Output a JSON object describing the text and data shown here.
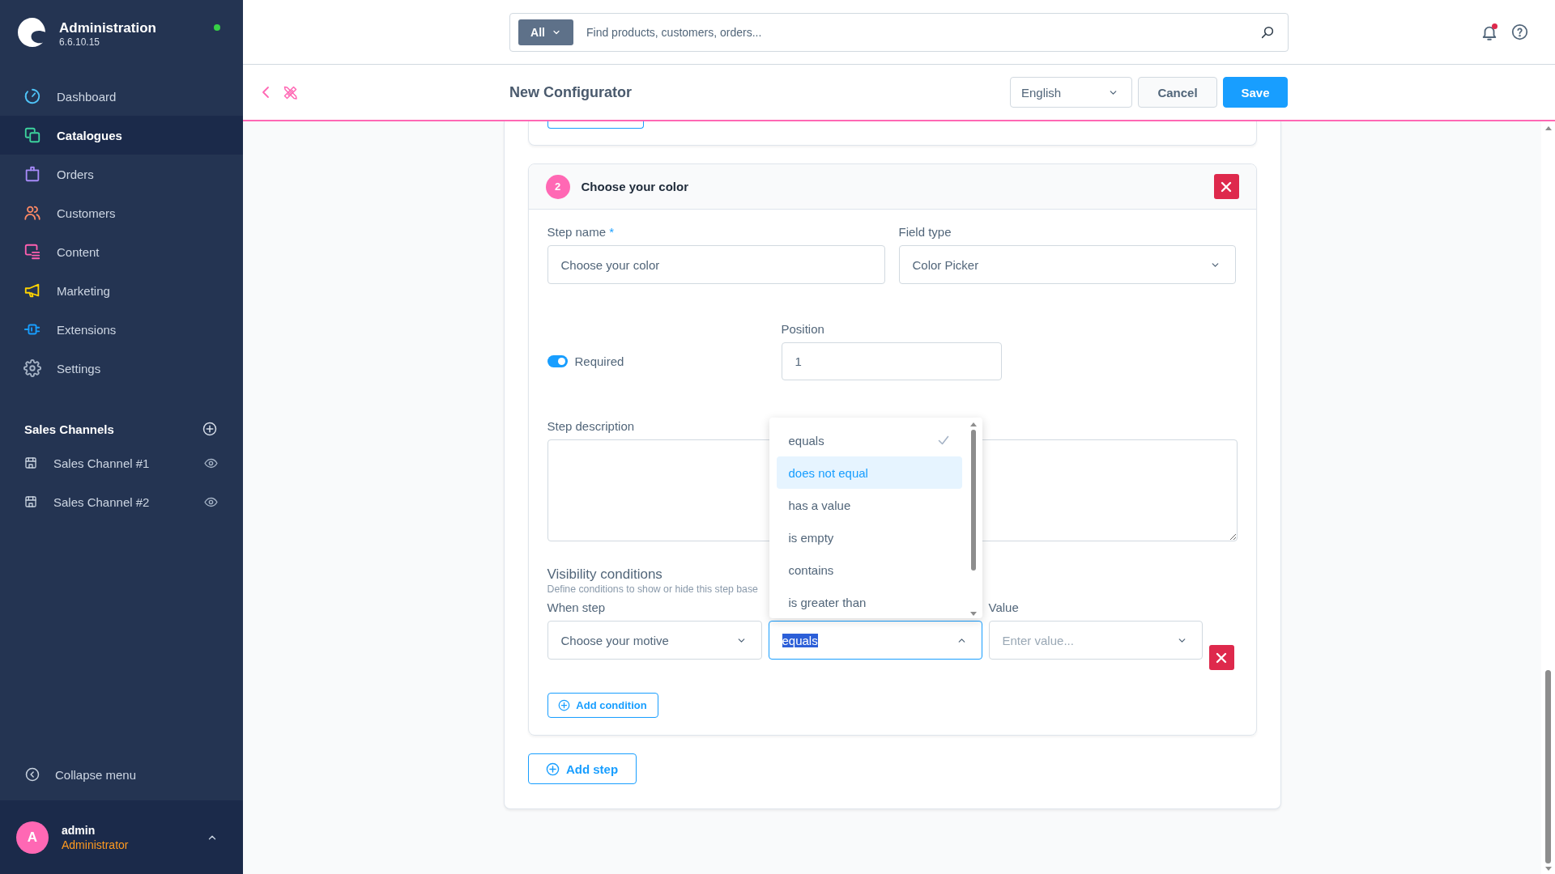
{
  "sidebar": {
    "brand": {
      "title": "Administration",
      "version": "6.6.10.15",
      "online": true
    },
    "nav": [
      {
        "label": "Dashboard",
        "selected": false
      },
      {
        "label": "Catalogues",
        "selected": true
      },
      {
        "label": "Orders",
        "selected": false
      },
      {
        "label": "Customers",
        "selected": false
      },
      {
        "label": "Content",
        "selected": false
      },
      {
        "label": "Marketing",
        "selected": false
      },
      {
        "label": "Extensions",
        "selected": false
      },
      {
        "label": "Settings",
        "selected": false
      }
    ],
    "sales_channels": {
      "title": "Sales Channels",
      "items": [
        {
          "label": "Sales Channel #1"
        },
        {
          "label": "Sales Channel #2"
        }
      ]
    },
    "collapse": {
      "label": "Collapse menu"
    },
    "user": {
      "initial": "A",
      "name": "admin",
      "role": "Administrator"
    }
  },
  "search": {
    "scope": "All",
    "placeholder": "Find products, customers, orders..."
  },
  "notifications": {
    "unread": true
  },
  "page": {
    "title": "New Configurator",
    "language": "English",
    "buttons": [
      {
        "label": "Cancel",
        "kind": "secondary"
      },
      {
        "label": "Save",
        "kind": "primary"
      }
    ]
  },
  "step": {
    "number": "2",
    "title": "Choose your color",
    "step_name": {
      "label": "Step name",
      "required_mark": "*",
      "value": "Choose your color"
    },
    "field_type": {
      "label": "Field type",
      "value": "Color Picker"
    },
    "required": {
      "label": "Required",
      "on": true
    },
    "position": {
      "label": "Position",
      "value": "1"
    },
    "description": {
      "label": "Step description"
    },
    "visibility": {
      "title": "Visibility conditions",
      "hint": "Define conditions to show or hide this step base",
      "conditions": [
        {
          "when_label": "When step",
          "when_value": "Choose your motive",
          "operator": {
            "value": "equals",
            "expanded": true,
            "text_selected": true,
            "options": [
              {
                "label": "equals",
                "selected": true,
                "hovered": false
              },
              {
                "label": "does not equal",
                "selected": false,
                "hovered": true
              },
              {
                "label": "has a value",
                "selected": false,
                "hovered": false
              },
              {
                "label": "is empty",
                "selected": false,
                "hovered": false
              },
              {
                "label": "contains",
                "selected": false,
                "hovered": false
              },
              {
                "label": "is greater than",
                "selected": false,
                "hovered": false
              }
            ]
          },
          "value_label": "Value",
          "value_placeholder": "Enter value..."
        }
      ],
      "add_button": "Add condition"
    }
  },
  "add_step": "Add step"
}
